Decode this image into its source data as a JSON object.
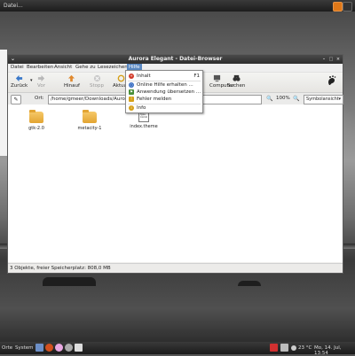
{
  "top_panel": {
    "task_label": "Datei..."
  },
  "window": {
    "title": "Aurora Elegant - Datei-Browser",
    "menu_glyph": "⌄",
    "menubar": [
      "Datei",
      "Bearbeiten",
      "Ansicht",
      "Gehe zu",
      "Lesezeichen",
      "Hilfe"
    ],
    "toolbar": {
      "back": "Zurück",
      "forward": "Vor",
      "up": "Hinauf",
      "stop": "Stopp",
      "reload": "Aktuali",
      "computer": "Computer",
      "search": "Suchen"
    },
    "location": {
      "label": "Ort:",
      "path": "/home/gmeer/Downloads/Aurora Ele",
      "zoom": "100%",
      "view": "Symbolansicht"
    },
    "files": [
      {
        "name": "gtk-2.0",
        "type": "folder"
      },
      {
        "name": "metacity-1",
        "type": "folder"
      },
      {
        "name": "index.theme",
        "type": "file",
        "preview": "Name Type Comm"
      }
    ],
    "status": "3 Objekte, freier Speicherplatz: 808,0 MB"
  },
  "help_menu": {
    "items": [
      {
        "label": "Inhalt",
        "accel": "F1",
        "icon": "lifebuoy-icon",
        "color": "#d23b2a"
      },
      {
        "label": "Online Hilfe erhalten ...",
        "accel": "",
        "icon": "globe-icon",
        "color": "#3a6fc4"
      },
      {
        "label": "Anwendung übersetzen ...",
        "accel": "",
        "icon": "flag-icon",
        "color": "#4a8f3a"
      },
      {
        "label": "Fehler melden",
        "accel": "",
        "icon": "bug-icon",
        "color": "#d6a018"
      },
      {
        "label": "Info",
        "accel": "",
        "icon": "info-icon",
        "color": "#d6a018"
      }
    ]
  },
  "bottom_panel": {
    "places": "Orte",
    "system": "System",
    "temperature": "23 °C",
    "clock": "Mo, 14. Jul, 13:54"
  },
  "colors": {
    "accent": "#5a88c2",
    "titlebar": "#2d2d2d",
    "folder": "#e2a432",
    "orange": "#e07818"
  }
}
